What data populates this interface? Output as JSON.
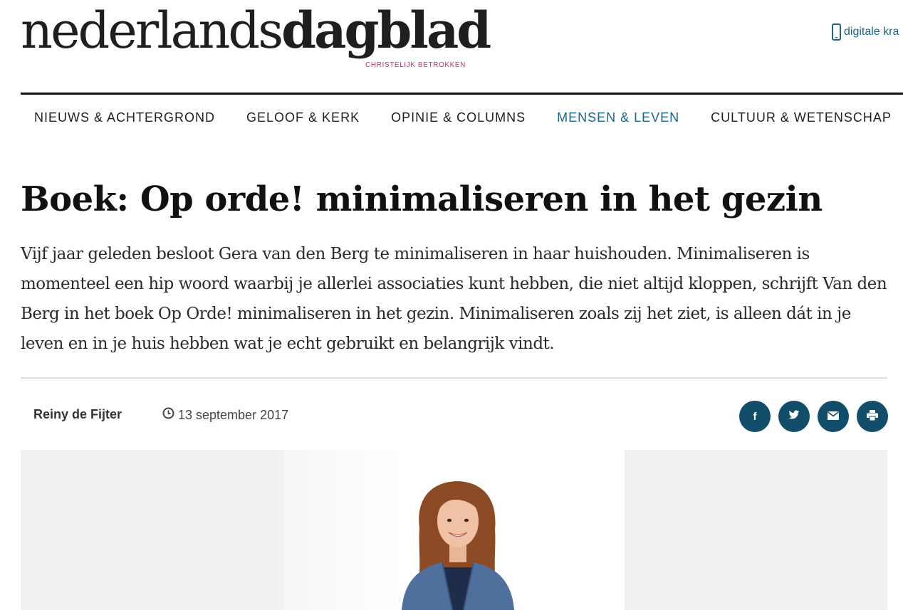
{
  "header": {
    "logo_light": "nederlands",
    "logo_bold": "dagblad",
    "tagline": "CHRISTELIJK BETROKKEN",
    "digital_link": "digitale kra",
    "digital_icon": "phone-icon"
  },
  "nav": {
    "items": [
      {
        "label": "NIEUWS & ACHTERGROND"
      },
      {
        "label": "GELOOF & KERK"
      },
      {
        "label": "OPINIE & COLUMNS"
      },
      {
        "label": "MENSEN & LEVEN",
        "active": true
      },
      {
        "label": "CULTUUR & WETENSCHAP"
      }
    ]
  },
  "article": {
    "title": "Boek: Op orde! minimaliseren in het gezin",
    "lead": "Vijf jaar geleden besloot Gera van den Berg te minimaliseren in haar huishouden. Minimaliseren is momenteel een hip woord waarbij je allerlei associaties kunt hebben, die niet altijd kloppen, schrijft Van den Berg in het boek Op Orde! minimaliseren in het gezin. Minimaliseren zoals zij het ziet, is alleen dát in je leven en in je huis hebben wat je echt gebruikt en belangrijk vindt.",
    "author": "Reiny de Fijter",
    "date": "13 september 2017"
  },
  "share": [
    {
      "name": "facebook-icon",
      "glyph": "f"
    },
    {
      "name": "twitter-icon",
      "glyph": "twitter"
    },
    {
      "name": "email-icon",
      "glyph": "envelope"
    },
    {
      "name": "print-icon",
      "glyph": "printer"
    }
  ],
  "colors": {
    "accent": "#1a6589",
    "share_button": "#124e6a",
    "tagline": "#c8316d",
    "rule": "#111111"
  }
}
